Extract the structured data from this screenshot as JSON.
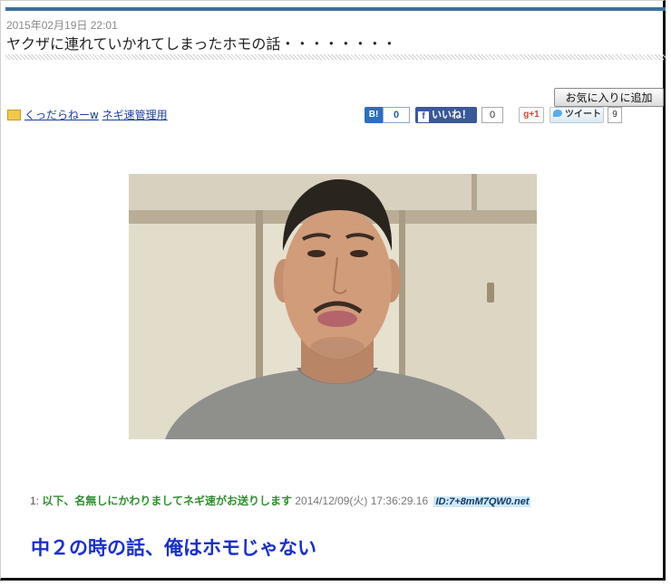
{
  "entry": {
    "date": "2015年02月19日 22:01",
    "title": "ヤクザに連れていかれてしまったホモの話・・・・・・・・"
  },
  "toolbar": {
    "favorite_label": "お気に入りに追加"
  },
  "category": {
    "icon": "folder-icon",
    "items": [
      {
        "label": "くっだらねーw"
      },
      {
        "label": "ネギ速管理用"
      }
    ]
  },
  "share": {
    "hatena": {
      "label": "B!",
      "count": "0",
      "icon": "hatena-bookmark-icon"
    },
    "facebook": {
      "label": "いいね！",
      "count": "0",
      "icon": "facebook-icon",
      "color": "#3b5998"
    },
    "googleplus": {
      "label": "g+1",
      "icon": "google-plus-icon"
    },
    "twitter": {
      "label": "ツイート",
      "count": "9",
      "icon": "twitter-icon",
      "color": "#55acee"
    }
  },
  "photo": {
    "subject": "portrait-photo"
  },
  "post": {
    "number": "1:",
    "name": "以下、名無しにかわりましてネギ速がお送りします",
    "datetime": "2014/12/09(火) 17:36:29.16",
    "id": "ID:7+8mM7QW0.net",
    "body": "中２の時の話、俺はホモじゃない"
  }
}
